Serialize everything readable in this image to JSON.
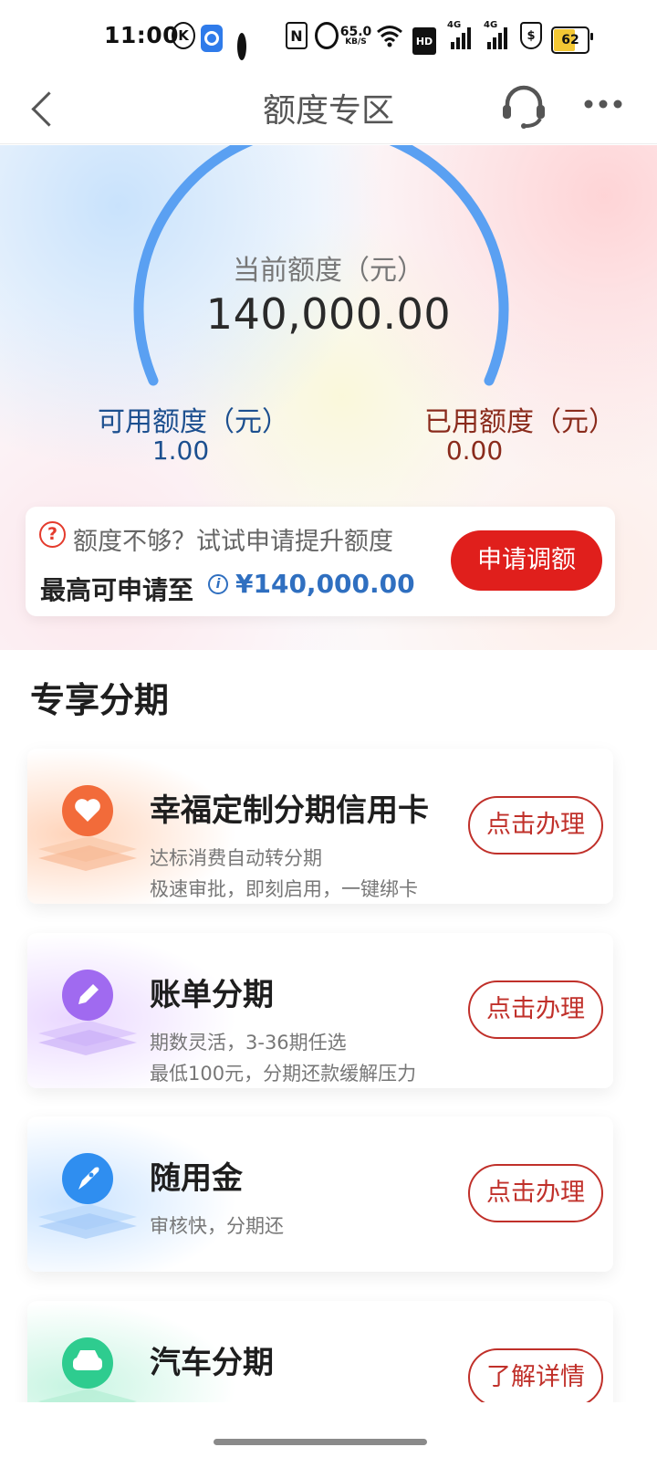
{
  "status_bar": {
    "time": "11:00",
    "k_badge": "K",
    "nfc": "N",
    "net_speed_value": "65.0",
    "net_speed_unit": "KB/S",
    "hd_badge": "HD",
    "signal_label_1": "4G",
    "signal_label_2": "4G",
    "shield_symbol": "$",
    "battery_level": "62",
    "battery_fraction": 0.62
  },
  "nav": {
    "title": "额度专区",
    "icons": [
      "back-icon",
      "headset-icon",
      "more-icon"
    ]
  },
  "credit": {
    "current_label": "当前额度（元）",
    "current_value": "140,000.00",
    "available_label": "可用额度（元）",
    "available_value": "1.00",
    "used_label": "已用额度（元）",
    "used_value": "0.00",
    "gauge_color": "#5aa0f2"
  },
  "raise": {
    "question_icon": "?",
    "prompt": "额度不够？试试申请提升额度",
    "max_label": "最高可申请至",
    "info_icon": "i",
    "max_amount": "¥140,000.00",
    "button": "申请调额",
    "button_color": "#e01f1c"
  },
  "section": {
    "title": "专享分期"
  },
  "products": [
    {
      "title": "幸福定制分期信用卡",
      "subtitle1": "达标消费自动转分期",
      "subtitle2": "极速审批，即刻启用，一键绑卡",
      "button": "点击办理",
      "icon": "heart-icon",
      "color": "#f26b3a"
    },
    {
      "title": "账单分期",
      "subtitle1": "期数灵活，3-36期任选",
      "subtitle2": "最低100元，分期还款缓解压力",
      "button": "点击办理",
      "icon": "pencil-icon",
      "color": "#a06af0"
    },
    {
      "title": "随用金",
      "subtitle1": "审核快，分期还",
      "button": "点击办理",
      "icon": "rocket-icon",
      "color": "#2f8ef0"
    },
    {
      "title": "汽车分期",
      "button": "了解详情",
      "icon": "car-icon",
      "color": "#2ecc8f"
    }
  ]
}
